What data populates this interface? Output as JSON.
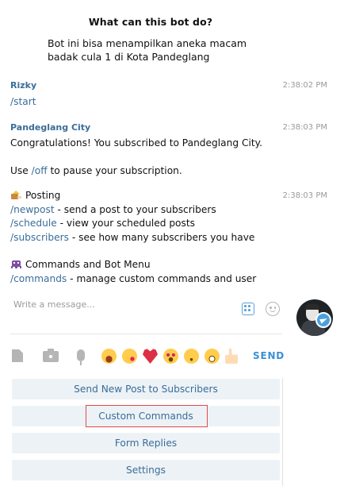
{
  "bot_info": {
    "title": "What can this bot do?",
    "description_line1": "Bot ini bisa menampilkan aneka macam",
    "description_line2": "badak cula 1 di Kota Pandeglang"
  },
  "messages": [
    {
      "sender": "Rizky",
      "time": "2:38:02 PM",
      "command": "/start"
    },
    {
      "sender": "Pandeglang City",
      "time": "2:38:03 PM",
      "text_congrats": "Congratulations! You subscribed to Pandeglang City.",
      "text_use_prefix": "Use",
      "command_off": "/off",
      "text_use_suffix": "to pause your subscription."
    },
    {
      "time": "2:38:03 PM",
      "posting_emoji": "posting-emoji-icon",
      "posting_title": "Posting",
      "lines": [
        {
          "cmd": "/newpost",
          "text": " - send a post to your subscribers"
        },
        {
          "cmd": "/schedule",
          "text": " - view your scheduled posts"
        },
        {
          "cmd": "/subscribers",
          "text": " - see how many subscribers you have"
        }
      ],
      "commands_emoji": "alien-monster-icon",
      "commands_title": "Commands and Bot Menu",
      "commands_line": {
        "cmd": "/commands",
        "text": " - manage custom commands and user"
      }
    }
  ],
  "composer": {
    "placeholder": "Write a message...",
    "commands_icon": "bot-commands-icon",
    "emoji_icon": "smile-icon"
  },
  "toolbar": {
    "icons": [
      "file-icon",
      "camera-icon",
      "microphone-icon"
    ],
    "quick_emojis": [
      "joy-emoji",
      "kiss-emoji",
      "heart-emoji",
      "heart-eyes-emoji",
      "blush-emoji",
      "grin-emoji",
      "thumbs-up-emoji"
    ],
    "send_label": "SEND"
  },
  "keyboard": {
    "buttons": [
      "Send New Post to Subscribers",
      "Custom Commands",
      "Form Replies",
      "Settings"
    ],
    "highlighted_index": 1,
    "highlight_color": "#e24a4a"
  },
  "colors": {
    "accent": "#3a6d99",
    "send": "#3a8fd6",
    "keyboard_bg": "#edf2f6"
  }
}
